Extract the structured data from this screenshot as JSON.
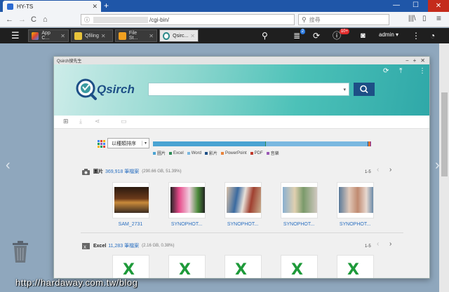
{
  "browser": {
    "tab_title": "HY-TS",
    "tab_close": "✕",
    "new_tab": "+",
    "win_minimize": "—",
    "win_maximize": "☐",
    "win_close": "✕",
    "nav_back": "←",
    "nav_forward": "→",
    "nav_reload": "C",
    "nav_home": "⌂",
    "url_lock": "ⓘ",
    "url_path": "/cgi-bin/",
    "search_placeholder": "搜尋",
    "search_icon": "⚲",
    "library_icon": "|||\\",
    "sidebar_icon": "▯",
    "menu_icon": "≡"
  },
  "qts": {
    "menu_glyph": "☰",
    "tabs": [
      {
        "label": "App C...",
        "close": "✕"
      },
      {
        "label": "Qfiling",
        "close": "✕"
      },
      {
        "label": "File St...",
        "close": "✕"
      },
      {
        "label": "Qsirc...",
        "close": "✕"
      }
    ],
    "search_glyph": "⚲",
    "tasks_badge": "2",
    "alerts_badge": "10+",
    "user": "admin ▾",
    "more_glyph": "⋮",
    "dashboard_glyph": "◔",
    "colors": {
      "accent": "#2a6fc0",
      "toolbar": "#1f1f1f",
      "alert_badge": "#e12c2c",
      "task_badge": "#2d7be0"
    }
  },
  "desktop": {
    "left_arrow": "‹",
    "right_arrow": "›",
    "watermark": "http://hardaway.com.tw/blog"
  },
  "qsirch": {
    "window_title": "Qsirch搜先生",
    "win_minimize": "−",
    "win_maximize": "+",
    "win_close": "✕",
    "logo_text": "Qsirch",
    "search_value": "",
    "search_caret": "▾",
    "banner_icons": {
      "refresh": "⟳",
      "upload": "⤒",
      "more": "⋮"
    },
    "sort_label": "以種類排序",
    "sort_caret": "▾",
    "distribution": [
      {
        "name": "圖片",
        "percent": 51.39,
        "color": "#4aa3d2"
      },
      {
        "name": "Excel",
        "percent": 0.38,
        "color": "#2e8b57"
      },
      {
        "name": "Word",
        "percent": 46.5,
        "color": "#7ab8e0"
      },
      {
        "name": "影片",
        "percent": 0.5,
        "color": "#1d4f86"
      },
      {
        "name": "PowerPoint",
        "percent": 0.6,
        "color": "#e8833a"
      },
      {
        "name": "PDF",
        "percent": 0.3,
        "color": "#c0392b"
      },
      {
        "name": "音樂",
        "percent": 0.33,
        "color": "#9b59b6"
      }
    ],
    "sections": [
      {
        "name": "圖片",
        "count": "369,918 筆檔案",
        "size": "(290.66 GB, 51.39%)",
        "pager": "1-5",
        "items": [
          "SAM_2731",
          "SYNOPHOT...",
          "SYNOPHOT...",
          "SYNOPHOT...",
          "SYNOPHOT..."
        ]
      },
      {
        "name": "Excel",
        "count": "11,283 筆檔案",
        "size": "(2.16 GB, 0.38%)",
        "pager": "1-5",
        "items": [
          "X",
          "X",
          "X",
          "X",
          "X"
        ]
      }
    ],
    "pager_prev": "‹",
    "pager_next": "›"
  }
}
